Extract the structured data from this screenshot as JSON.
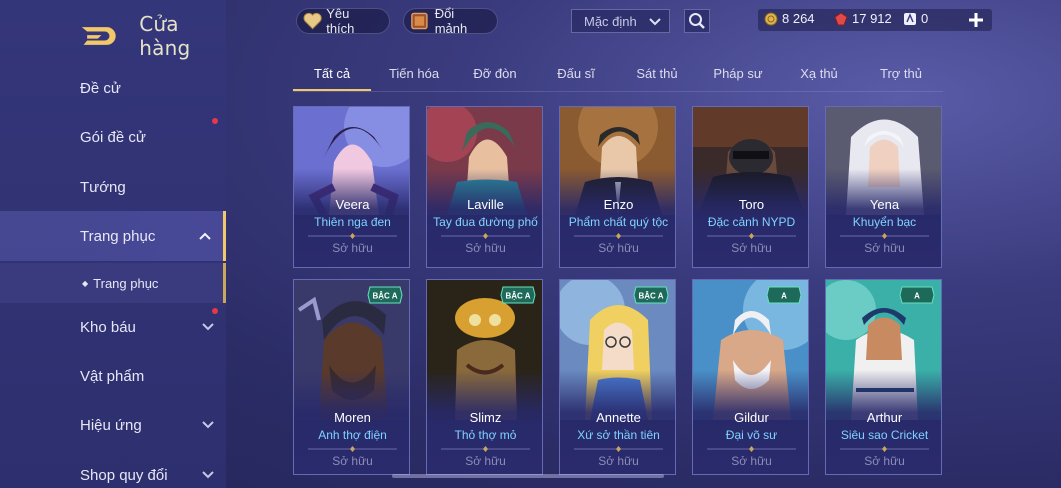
{
  "header": {
    "title": "Cửa hàng"
  },
  "topbar": {
    "favorites_label": "Yêu thích",
    "exchange_label": "Đổi mảnh",
    "sort_value": "Mặc định",
    "currencies": [
      {
        "icon": "gold-coin-icon",
        "value": "8 264"
      },
      {
        "icon": "ruby-icon",
        "value": "17 912"
      },
      {
        "icon": "voucher-icon",
        "value": "0"
      }
    ]
  },
  "sidebar": {
    "items": [
      {
        "label": "Đề cử"
      },
      {
        "label": "Gói đề cử"
      },
      {
        "label": "Tướng"
      },
      {
        "label": "Trang phục"
      },
      {
        "label": "Trang phục"
      },
      {
        "label": "Kho báu"
      },
      {
        "label": "Vật phẩm"
      },
      {
        "label": "Hiệu ứng"
      },
      {
        "label": "Shop quy đổi"
      }
    ]
  },
  "tabs": [
    "Tất cả",
    "Tiến hóa",
    "Đỡ đòn",
    "Đấu sĩ",
    "Sát thủ",
    "Pháp sư",
    "Xạ thủ",
    "Trợ thủ"
  ],
  "cards": [
    {
      "name": "Veera",
      "skin": "Thiên nga đen",
      "status": "Sở hữu"
    },
    {
      "name": "Laville",
      "skin": "Tay đua đường phố",
      "status": "Sở hữu"
    },
    {
      "name": "Enzo",
      "skin": "Phẩm chất quý tộc",
      "status": "Sở hữu"
    },
    {
      "name": "Toro",
      "skin": "Đặc cảnh NYPD",
      "status": "Sở hữu"
    },
    {
      "name": "Yena",
      "skin": "Khuyển bạc",
      "status": "Sở hữu"
    },
    {
      "name": "Moren",
      "skin": "Anh thợ điện",
      "status": "Sở hữu",
      "badge": "BẬC A"
    },
    {
      "name": "Slimz",
      "skin": "Thỏ thợ mỏ",
      "status": "Sở hữu",
      "badge": "BẬC A"
    },
    {
      "name": "Annette",
      "skin": "Xứ sở thần tiên",
      "status": "Sở hữu",
      "badge": "BẬC A"
    },
    {
      "name": "Gildur",
      "skin": "Đại võ sư",
      "status": "Sở hữu",
      "badge": "A"
    },
    {
      "name": "Arthur",
      "skin": "Siêu sao Cricket",
      "status": "Sở hữu",
      "badge": "A"
    }
  ],
  "colors": {
    "accent": "#f2c96a",
    "skin_text": "#7fd3ff",
    "notification": "#e8374a"
  }
}
